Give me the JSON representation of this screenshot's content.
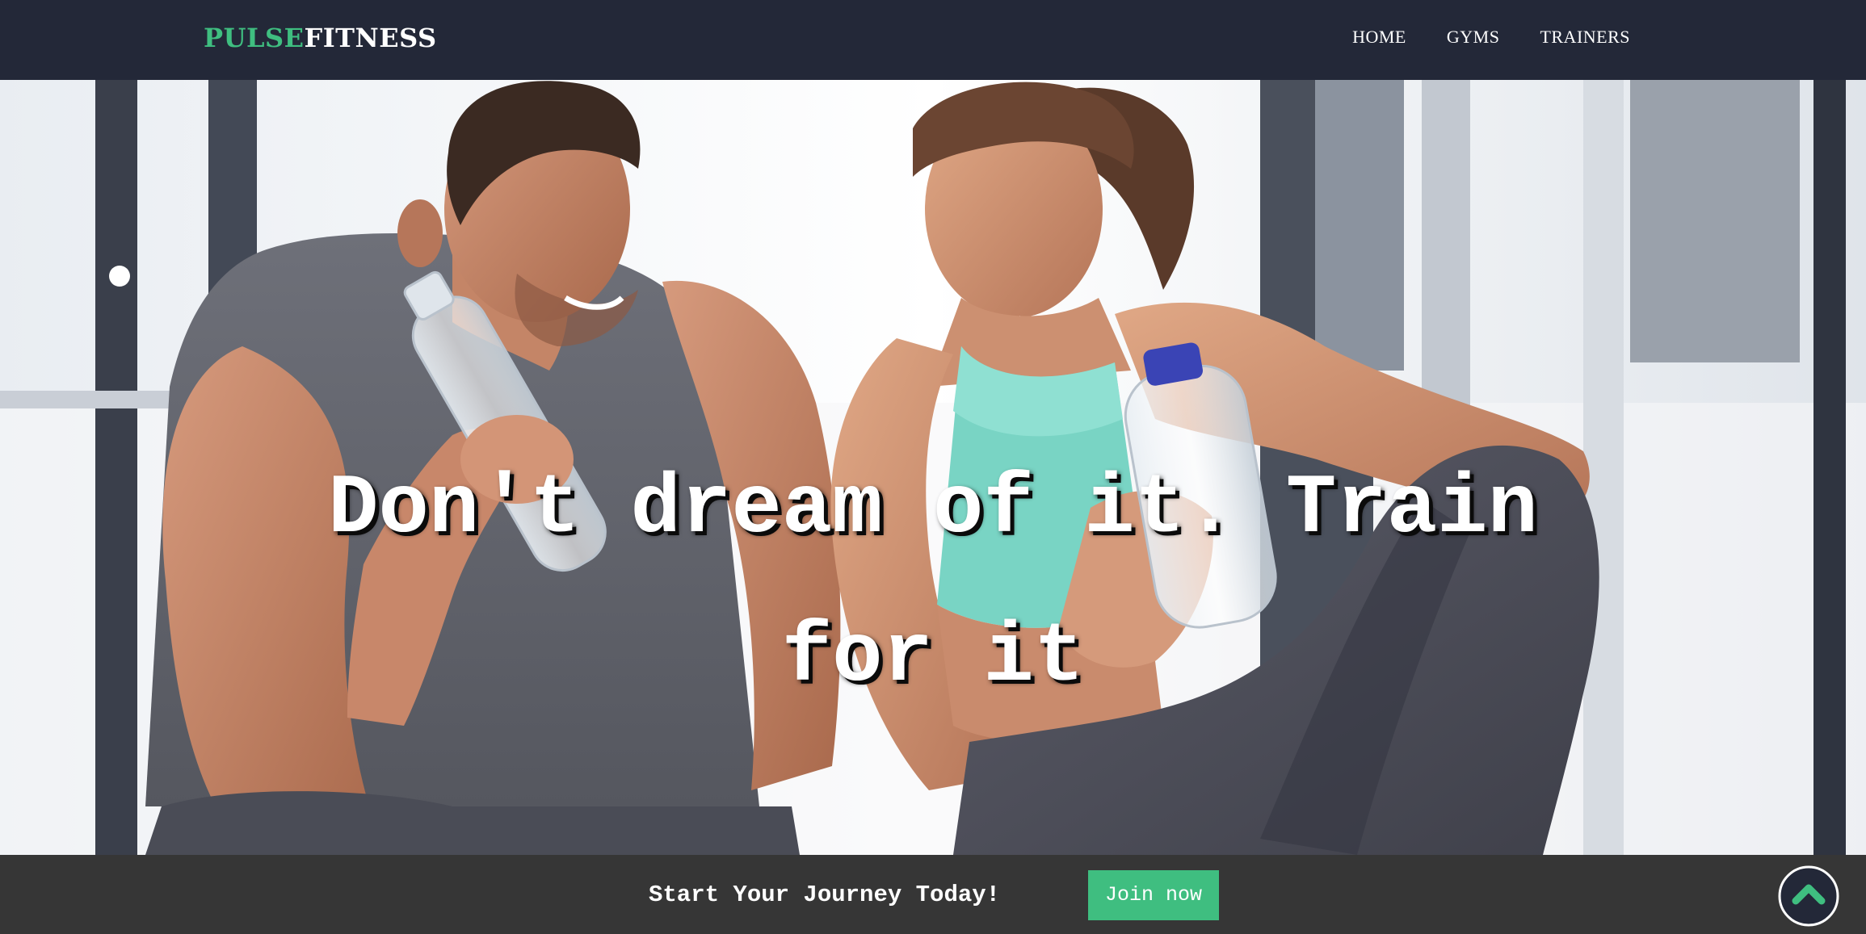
{
  "navbar": {
    "brand_accent": "PULSE",
    "brand_rest": "FITNESS",
    "links": [
      "HOME",
      "GYMS",
      "TRAINERS"
    ]
  },
  "hero": {
    "heading": "Don't dream of it. Train for it"
  },
  "cta_bar": {
    "text": "Start Your Journey Today!",
    "button_label": "Join now",
    "scroll_top_icon": "chevron-up-icon"
  },
  "colors": {
    "navbar_bg": "#232838",
    "accent": "#3fbe80",
    "cta_bar_bg": "#363636"
  }
}
